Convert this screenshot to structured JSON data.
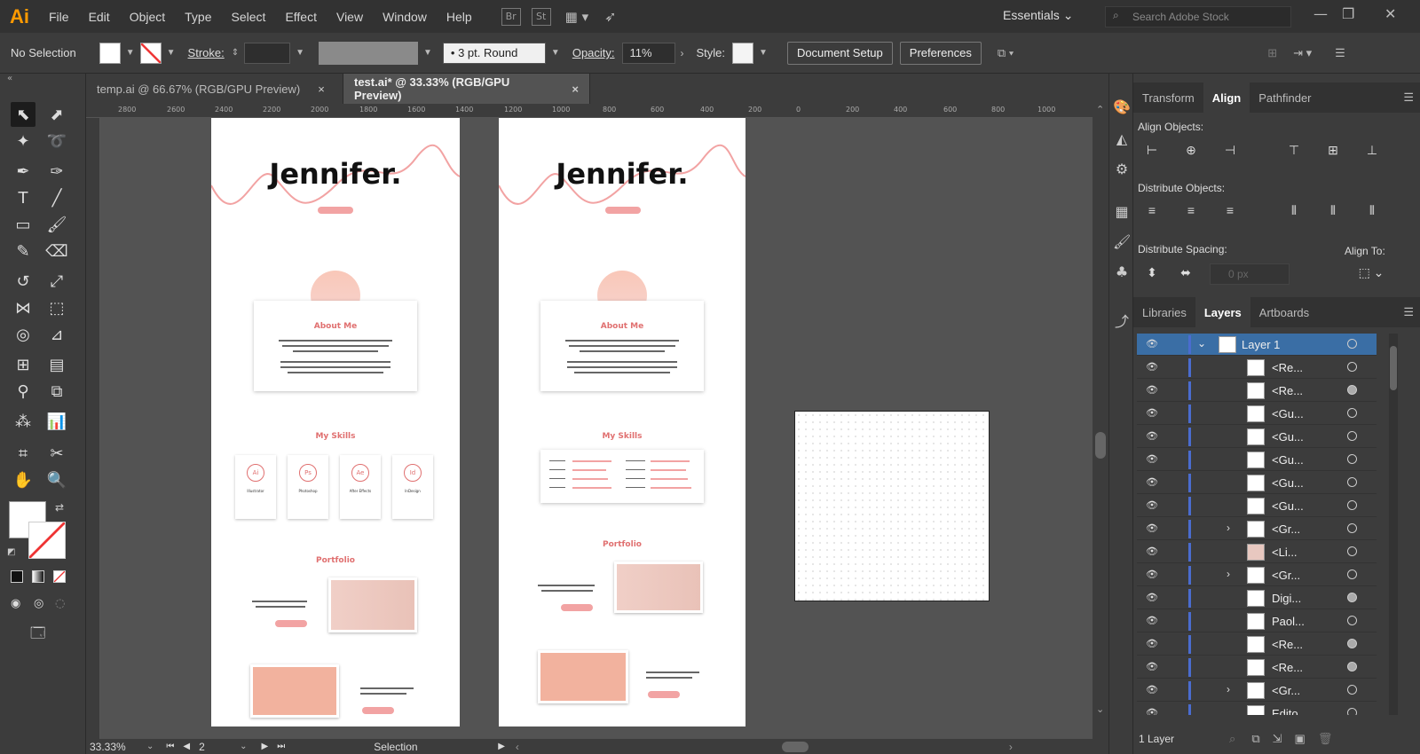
{
  "app": {
    "logo": "Ai"
  },
  "menu": [
    "File",
    "Edit",
    "Object",
    "Type",
    "Select",
    "Effect",
    "View",
    "Window",
    "Help"
  ],
  "bridge": [
    "Br",
    "St"
  ],
  "workspace": "Essentials",
  "search": {
    "placeholder": "Search Adobe Stock"
  },
  "control": {
    "selection": "No Selection",
    "stroke_label": "Stroke:",
    "brush": "3 pt. Round",
    "opacity_label": "Opacity:",
    "opacity_value": "11%",
    "style_label": "Style:",
    "doc_setup": "Document Setup",
    "preferences": "Preferences"
  },
  "tabs": [
    {
      "label": "temp.ai @ 66.67% (RGB/GPU Preview)",
      "close": "×"
    },
    {
      "label": "test.ai* @ 33.33% (RGB/GPU Preview)",
      "close": "×"
    }
  ],
  "ruler_marks": [
    "2800",
    "2600",
    "2400",
    "2200",
    "2000",
    "1800",
    "1600",
    "1400",
    "1200",
    "1000",
    "800",
    "600",
    "400",
    "200",
    "0",
    "200",
    "400",
    "600",
    "800",
    "1000"
  ],
  "artboard": {
    "name": "Jennifer.",
    "about": "About Me",
    "skills": "My Skills",
    "portfolio": "Portfolio",
    "skill_icons": [
      "Ai",
      "Ps",
      "Ae",
      "Id"
    ],
    "skill_names": [
      "Illustrator",
      "Photoshop",
      "After Effects",
      "InDesign"
    ]
  },
  "status": {
    "zoom": "33.33%",
    "page": "2",
    "tool": "Selection"
  },
  "align_panel": {
    "tabs": [
      "Transform",
      "Align",
      "Pathfinder"
    ],
    "align_objects": "Align Objects:",
    "distribute_objects": "Distribute Objects:",
    "distribute_spacing": "Distribute Spacing:",
    "align_to": "Align To:",
    "spacing_value": "0 px"
  },
  "layers_panel": {
    "tabs": [
      "Libraries",
      "Layers",
      "Artboards"
    ],
    "layer_name": "Layer 1",
    "rows": [
      "<Re...",
      "<Re...",
      "<Gu...",
      "<Gu...",
      "<Gu...",
      "<Gu...",
      "<Gu...",
      "<Gr...",
      "<Li...",
      "<Gr...",
      "Digi...",
      "Paol...",
      "<Re...",
      "<Re...",
      "<Gr...",
      "Edito..."
    ],
    "footer": "1 Layer"
  },
  "colors": {
    "accent": "#e07070",
    "selection_blue": "#3a6ea5",
    "layer_color": "#4a6ccf",
    "logo": "#ff9a00"
  }
}
